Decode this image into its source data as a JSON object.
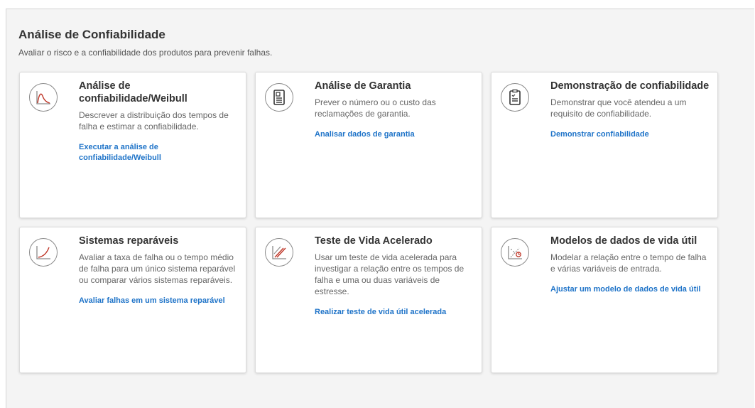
{
  "header": {
    "title": "Análise de Confiabilidade",
    "subtitle": "Avaliar o risco e a confiabilidade dos produtos para prevenir falhas."
  },
  "cards": [
    {
      "title": "Análise de confiabilidade/Weibull",
      "description": "Descrever a distribuição dos tempos de falha e estimar a confiabilidade.",
      "link": "Executar a análise de confiabilidade/Weibull",
      "icon": "weibull-curve-icon"
    },
    {
      "title": "Análise de Garantia",
      "description": "Prever o número ou o custo das reclamações de garantia.",
      "link": "Analisar dados de garantia",
      "icon": "warranty-document-icon"
    },
    {
      "title": "Demonstração de confiabilidade",
      "description": "Demonstrar que você atendeu a um requisito de confiabilidade.",
      "link": "Demonstrar confiabilidade",
      "icon": "clipboard-check-icon"
    },
    {
      "title": "Sistemas reparáveis",
      "description": "Avaliar a taxa de falha ou o tempo médio de falha para um único sistema reparável ou comparar vários sistemas reparáveis.",
      "link": "Avaliar falhas em um sistema reparável",
      "icon": "growth-curve-icon"
    },
    {
      "title": "Teste de Vida Acelerado",
      "description": "Usar um teste de vida acelerada para investigar a relação entre os tempos de falha e uma ou duas variáveis de estresse.",
      "link": "Realizar teste de vida útil acelerada",
      "icon": "parallel-lines-icon"
    },
    {
      "title": "Modelos de dados de vida útil",
      "description": "Modelar a relação entre o tempo de falha e várias variáveis de entrada.",
      "link": "Ajustar um modelo de dados de vida útil",
      "icon": "regression-target-icon"
    }
  ],
  "colors": {
    "link": "#1e73c8",
    "icon_stroke": "#8a8a8a",
    "icon_accent": "#c0392b"
  }
}
